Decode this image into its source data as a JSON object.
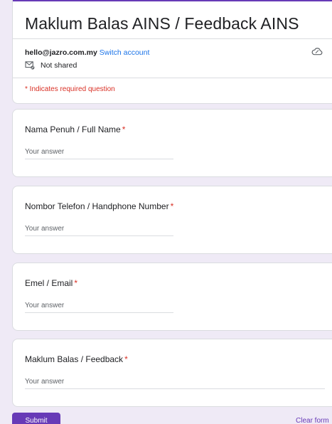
{
  "form": {
    "title": "Maklum Balas AINS / Feedback AINS",
    "account_email": "hello@jazro.com.my",
    "switch_account": "Switch account",
    "not_shared": "Not shared",
    "required_note": "* Indicates required question"
  },
  "questions": [
    {
      "label": "Nama Penuh / Full Name",
      "required_mark": "*",
      "placeholder": "Your answer"
    },
    {
      "label": "Nombor Telefon / Handphone Number",
      "required_mark": "*",
      "placeholder": "Your answer"
    },
    {
      "label": "Emel / Email",
      "required_mark": "*",
      "placeholder": "Your answer"
    },
    {
      "label": "Maklum Balas / Feedback",
      "required_mark": "*",
      "placeholder": "Your answer"
    }
  ],
  "actions": {
    "submit_label": "Submit",
    "clear_label": "Clear form"
  },
  "colors": {
    "accent": "#673ab7",
    "required": "#d93025",
    "link": "#1a73e8",
    "background": "#efeaf6"
  },
  "icons": {
    "cloud": "cloud-off-icon",
    "not_shared": "mail-not-shared-icon"
  }
}
